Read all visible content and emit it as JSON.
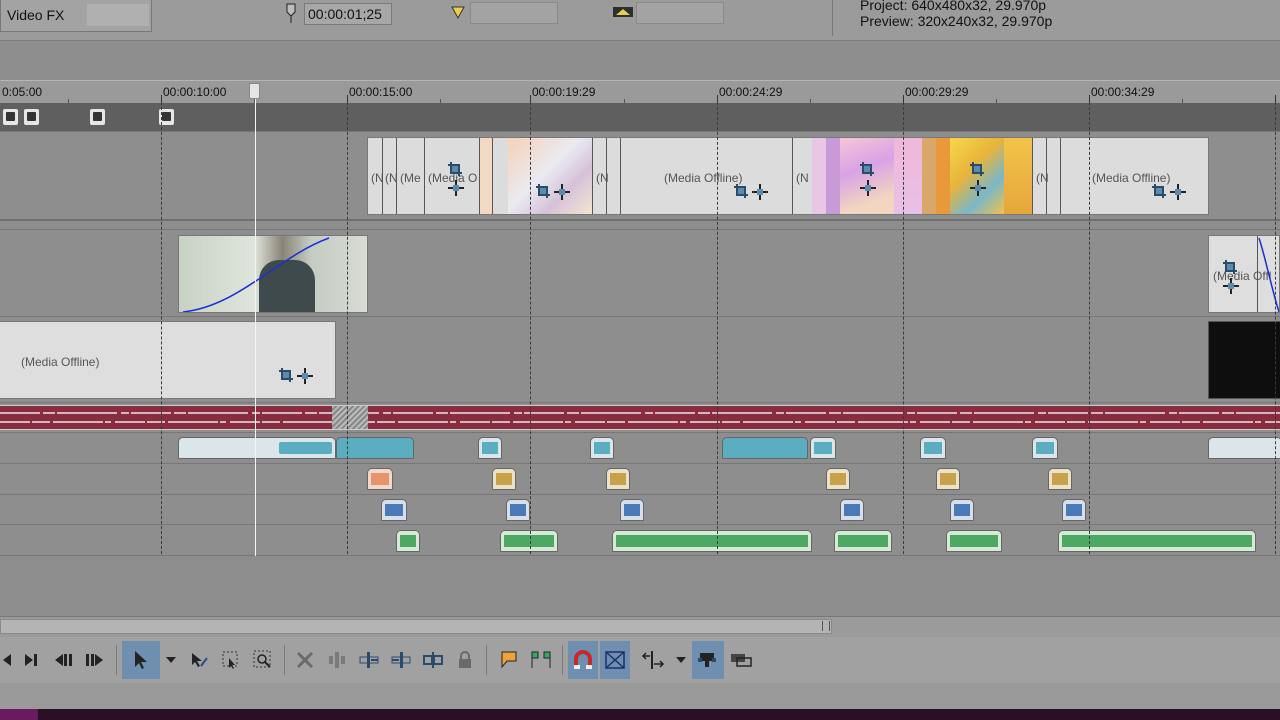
{
  "top_panel": {
    "videofx_label": "Video FX",
    "cursor_time": "00:00:01;25",
    "project_info": "Project:   640x480x32, 29.970p",
    "preview_info": "Preview:  320x240x32, 29.970p"
  },
  "ruler": {
    "labels": [
      "0:05:00",
      "00:00:10:00",
      "00:00:15:00",
      "00:00:19:29",
      "00:00:24:29",
      "00:00:29:29",
      "00:00:34:29"
    ]
  },
  "tracks": {
    "video1_labels": [
      "(N",
      "(N",
      "(Me",
      "(Media O",
      "(N",
      "(Media Offline)",
      "(N",
      "(N",
      "(Media Offline)"
    ],
    "video2_labels": [
      "(Media Offl"
    ],
    "video3_labels": [
      "(Media Offline)"
    ]
  },
  "colors": {
    "track_bg": "#8e8e8e",
    "audio_main": "#8a2c40",
    "audio_teal": "#5aaec0",
    "audio_orange": "#e8946b",
    "audio_gold": "#c8a24a",
    "audio_blue": "#4a79b8",
    "audio_green": "#4ea864",
    "toolbar_active": "#6e8fb0"
  },
  "toolbar": {
    "buttons": [
      "go-to-start-icon",
      "go-to-end-icon",
      "prev-frame-icon",
      "next-frame-icon",
      "normal-edit-tool-icon",
      "dropdown-arrow-icon",
      "envelope-edit-tool-icon",
      "selection-edit-tool-icon",
      "zoom-edit-tool-icon",
      "delete-icon",
      "trim-icon",
      "trim-start-icon",
      "trim-end-icon",
      "split-icon",
      "lock-icon",
      "marker-icon",
      "region-icon",
      "snapping-icon",
      "auto-crossfade-icon",
      "auto-ripple-icon",
      "dropdown-arrow-icon",
      "lock-envelopes-icon",
      "ignore-grouping-icon"
    ]
  }
}
